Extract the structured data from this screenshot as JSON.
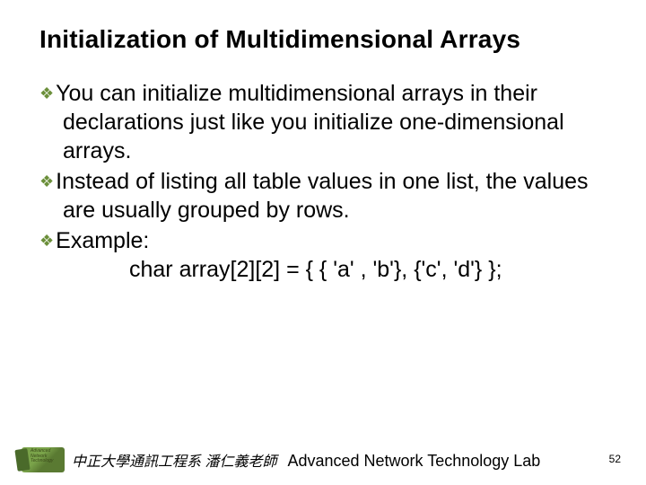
{
  "title": "Initialization of Multidimensional Arrays",
  "bullets": [
    "You can initialize multidimensional arrays in their declarations just like you initialize one-dimensional arrays.",
    "Instead of listing all table values in one list, the values are usually grouped by rows.",
    "Example:"
  ],
  "code_line": "char array[2][2] = { { 'a' , 'b'}, {'c', 'd'} };",
  "footer": {
    "logo_lines": "Advanced\nNetwork\nTechnology",
    "chinese": "中正大學通訊工程系 潘仁義老師",
    "english": "Advanced Network Technology Lab"
  },
  "page_number": "52"
}
